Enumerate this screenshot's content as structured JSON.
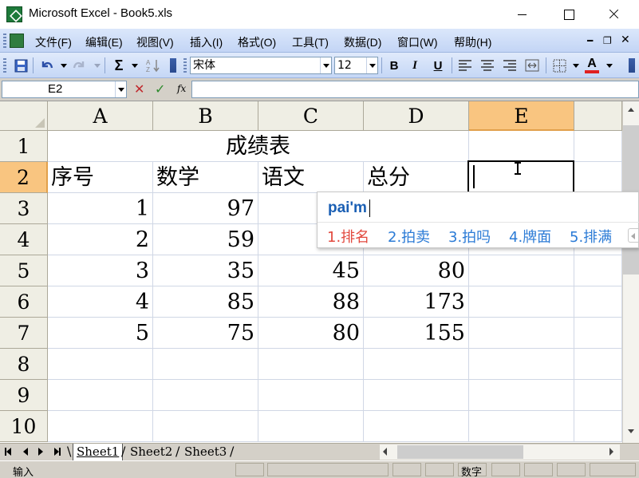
{
  "window": {
    "title": "Microsoft Excel - Book5.xls"
  },
  "menu": [
    "文件(F)",
    "编辑(E)",
    "视图(V)",
    "插入(I)",
    "格式(O)",
    "工具(T)",
    "数据(D)",
    "窗口(W)",
    "帮助(H)"
  ],
  "toolbar": {
    "sum_symbol": "Σ",
    "font_name": "宋体",
    "font_size": "12",
    "bold": "B",
    "italic": "I",
    "underline": "U",
    "font_color_label": "A",
    "font_color": "#e02020"
  },
  "formula_bar": {
    "name_box": "E2",
    "fx": "fx",
    "value": ""
  },
  "columns": [
    "A",
    "B",
    "C",
    "D",
    "E"
  ],
  "rows": [
    "1",
    "2",
    "3",
    "4",
    "5",
    "6",
    "7",
    "8",
    "9",
    "10"
  ],
  "cells": {
    "title": "成绩表",
    "headers": [
      "序号",
      "数学",
      "语文",
      "总分"
    ],
    "data": [
      [
        "1",
        "97",
        "",
        ""
      ],
      [
        "2",
        "59",
        "",
        ""
      ],
      [
        "3",
        "35",
        "45",
        "80"
      ],
      [
        "4",
        "85",
        "88",
        "173"
      ],
      [
        "5",
        "75",
        "80",
        "155"
      ]
    ]
  },
  "ime": {
    "composition": "pai'm",
    "candidates": [
      "1.排名",
      "2.拍卖",
      "3.拍吗",
      "4.牌面",
      "5.排满"
    ]
  },
  "sheets": [
    "Sheet1",
    "Sheet2",
    "Sheet3"
  ],
  "active_sheet": "Sheet1",
  "status": {
    "mode": "输入",
    "num_lock": "数字"
  },
  "colors": {
    "header_active": "#f9c580",
    "ime_first": "#e2493e",
    "ime_other": "#2b7bd6"
  }
}
